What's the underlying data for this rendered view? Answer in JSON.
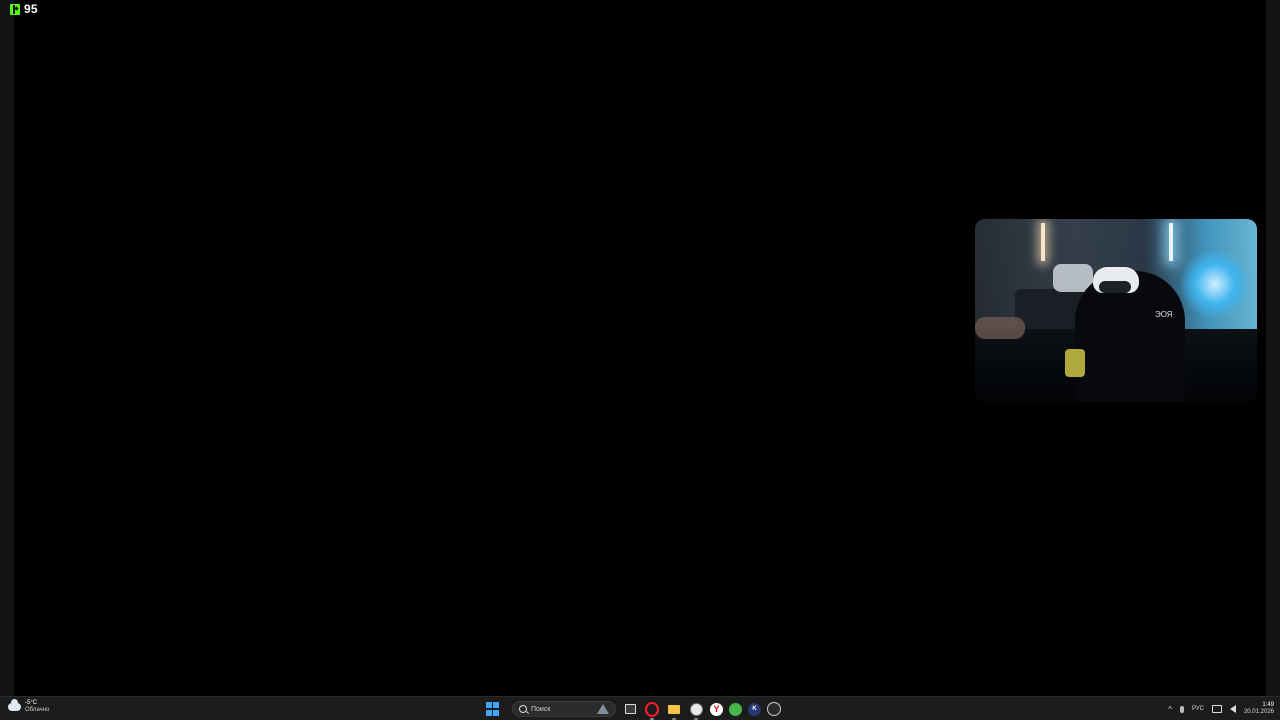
{
  "stream": {
    "viewer_count": "95",
    "webcam_overlay_text": "ЭОЯ"
  },
  "taskbar": {
    "weather": {
      "temp": "-5°C",
      "condition": "Облачно",
      "icon": "cloud-icon"
    },
    "search": {
      "label": "Поиск"
    },
    "apps": [
      {
        "name": "task-view",
        "icon": "task-view-icon"
      },
      {
        "name": "opera",
        "icon": "opera-icon"
      },
      {
        "name": "file-explorer",
        "icon": "folder-icon"
      },
      {
        "name": "steam",
        "icon": "steam-icon"
      },
      {
        "name": "yandex",
        "icon": "yandex-icon",
        "glyph": "Y"
      },
      {
        "name": "green-app",
        "icon": "green-app-icon"
      },
      {
        "name": "blue-app",
        "icon": "blue-app-icon",
        "glyph": "K"
      },
      {
        "name": "obs",
        "icon": "obs-icon"
      }
    ],
    "tray": {
      "language": "РУС",
      "time": "1:49",
      "date": "20.01.2026"
    }
  },
  "colors": {
    "kick_green": "#53fc18",
    "taskbar_bg": "#1c1c1c",
    "start_blue": "#3fa7ff"
  }
}
